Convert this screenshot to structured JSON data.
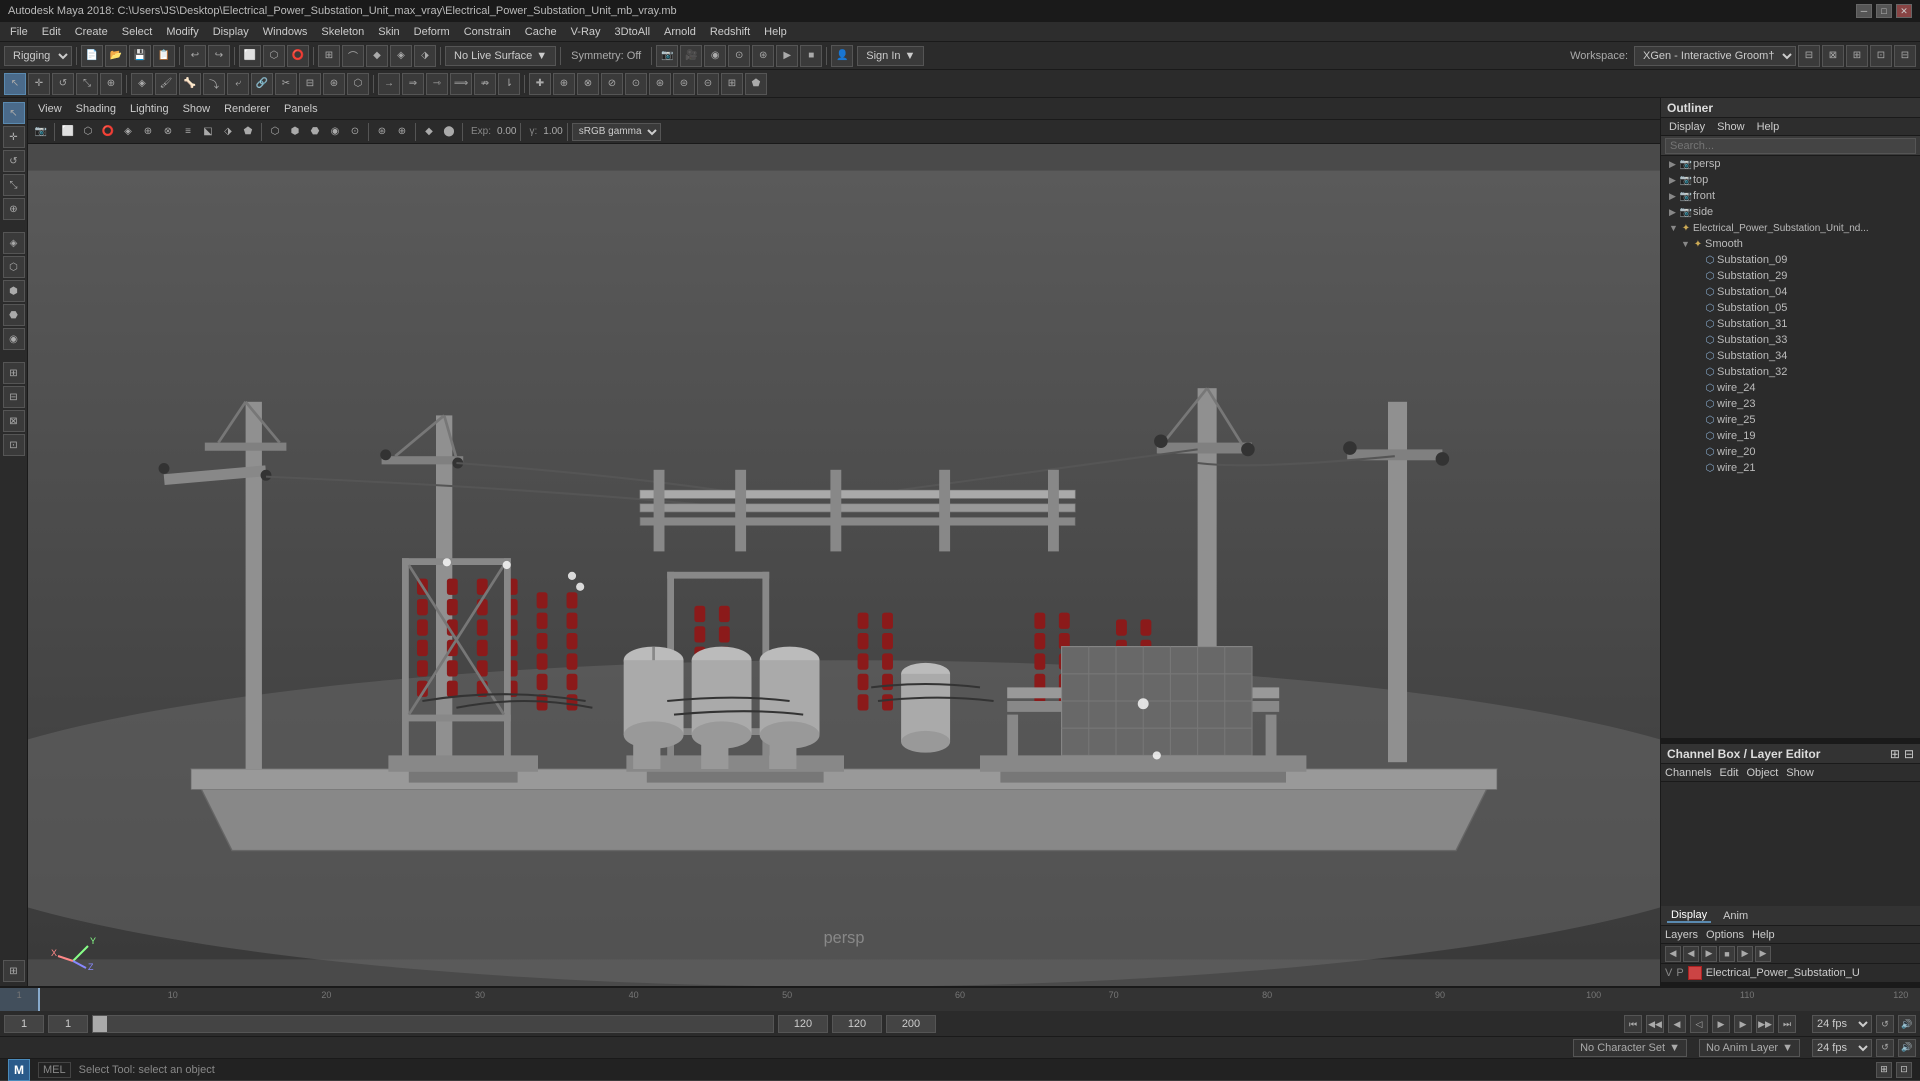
{
  "titlebar": {
    "title": "Autodesk Maya 2018: C:\\Users\\JS\\Desktop\\Electrical_Power_Substation_Unit_max_vray\\Electrical_Power_Substation_Unit_mb_vray.mb",
    "minimize": "─",
    "restore": "□",
    "close": "✕"
  },
  "menubar": {
    "items": [
      "File",
      "Edit",
      "Create",
      "Select",
      "Modify",
      "Display",
      "Windows",
      "Skeleton",
      "Skin",
      "Deform",
      "Constrain",
      "Cache",
      "V-Ray",
      "3DtoAll",
      "Arnold",
      "Redshift",
      "Help"
    ]
  },
  "toolbar": {
    "rigging_label": "Rigging",
    "no_live_surface": "No Live Surface",
    "symmetry_off": "Symmetry: Off",
    "sign_in": "Sign In",
    "workspace": "XGen - Interactive Groom†"
  },
  "viewport": {
    "menus": [
      "View",
      "Shading",
      "Lighting",
      "Show",
      "Renderer",
      "Panels"
    ],
    "label": "persp",
    "exposure_value": "0.00",
    "gamma_value": "1.00",
    "gamma_label": "sRGB gamma"
  },
  "outliner": {
    "title": "Outliner",
    "menu_items": [
      "Display",
      "Show",
      "Help"
    ],
    "search_placeholder": "Search...",
    "items": [
      {
        "id": "persp",
        "label": "persp",
        "indent": 1,
        "type": "camera",
        "expanded": false
      },
      {
        "id": "top",
        "label": "top",
        "indent": 1,
        "type": "camera",
        "expanded": false
      },
      {
        "id": "front",
        "label": "front",
        "indent": 1,
        "type": "camera",
        "expanded": false
      },
      {
        "id": "side",
        "label": "side",
        "indent": 1,
        "type": "camera",
        "expanded": false
      },
      {
        "id": "electrical_root",
        "label": "Electrical_Power_Substation_Unit_nd...",
        "indent": 1,
        "type": "group",
        "expanded": true
      },
      {
        "id": "smooth",
        "label": "Smooth",
        "indent": 2,
        "type": "smooth",
        "expanded": true
      },
      {
        "id": "substation_09",
        "label": "Substation_09",
        "indent": 3,
        "type": "mesh"
      },
      {
        "id": "substation_29",
        "label": "Substation_29",
        "indent": 3,
        "type": "mesh"
      },
      {
        "id": "substation_04",
        "label": "Substation_04",
        "indent": 3,
        "type": "mesh"
      },
      {
        "id": "substation_05",
        "label": "Substation_05",
        "indent": 3,
        "type": "mesh"
      },
      {
        "id": "substation_31",
        "label": "Substation_31",
        "indent": 3,
        "type": "mesh"
      },
      {
        "id": "substation_33",
        "label": "Substation_33",
        "indent": 3,
        "type": "mesh"
      },
      {
        "id": "substation_34",
        "label": "Substation_34",
        "indent": 3,
        "type": "mesh"
      },
      {
        "id": "substation_32",
        "label": "Substation_32",
        "indent": 3,
        "type": "mesh"
      },
      {
        "id": "wire_24",
        "label": "wire_24",
        "indent": 3,
        "type": "mesh"
      },
      {
        "id": "wire_23",
        "label": "wire_23",
        "indent": 3,
        "type": "mesh"
      },
      {
        "id": "wire_25",
        "label": "wire_25",
        "indent": 3,
        "type": "mesh"
      },
      {
        "id": "wire_19",
        "label": "wire_19",
        "indent": 3,
        "type": "mesh"
      },
      {
        "id": "wire_20",
        "label": "wire_20",
        "indent": 3,
        "type": "mesh"
      },
      {
        "id": "wire_21",
        "label": "wire_21",
        "indent": 3,
        "type": "mesh"
      }
    ]
  },
  "channel_box": {
    "title": "Channel Box / Layer Editor",
    "menu_items": [
      "Channels",
      "Edit",
      "Object",
      "Show"
    ],
    "display_tab": "Display",
    "anim_tab": "Anim",
    "layers_item": "Layers",
    "options_item": "Options",
    "help_item": "Help",
    "layer_name": "Electrical_Power_Substation_U",
    "layer_color": "#cc4444"
  },
  "timeline": {
    "start_frame": "1",
    "end_frame": "120",
    "current_frame": "1",
    "range_start": "1",
    "range_end": "120",
    "anim_end": "200",
    "fps": "24 fps",
    "tick_labels": [
      "1",
      "10",
      "20",
      "30",
      "40",
      "50",
      "60",
      "70",
      "80",
      "90",
      "100",
      "110",
      "120"
    ],
    "tick_positions": [
      0,
      8,
      16,
      25,
      33,
      42,
      50,
      58,
      67,
      75,
      83,
      92,
      100
    ]
  },
  "anim_bar": {
    "no_character_set": "No Character Set",
    "no_anim_layer": "No Anim Layer",
    "fps_label": "24 fps"
  },
  "status_bar": {
    "mel_label": "MEL",
    "status_text": "Select Tool: select an object"
  },
  "playback": {
    "goto_start": "⏮",
    "prev_key": "◀◀",
    "prev_frame": "◀",
    "play_back": "◁",
    "play_fwd": "▶",
    "next_frame": "▶",
    "next_key": "▶▶",
    "goto_end": "⏭"
  }
}
